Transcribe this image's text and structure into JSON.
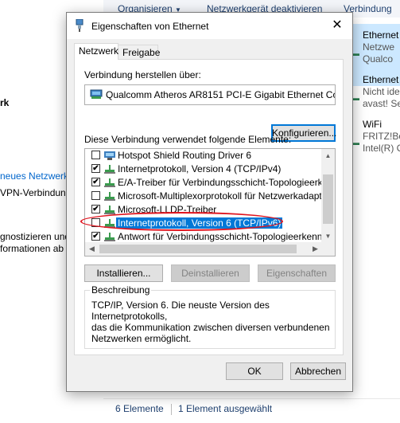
{
  "background": {
    "toolbar": {
      "organize": "Organisieren",
      "organize_arrow": "▼",
      "disable_device": "Netzwerkgerät deaktivieren",
      "connect": "Verbindung"
    },
    "left_pane": {
      "line1": "rk",
      "line2": "neues Netzwerk",
      "line3": "VPN-Verbindung",
      "line4": "gnostizieren und",
      "line5": "formationen ab"
    },
    "connections": [
      {
        "name": "Ethernet",
        "line2": "Netzwe",
        "line3": "Qualco"
      },
      {
        "name": "Ethernet",
        "line2": "Nicht ide",
        "line3": "avast! Se"
      },
      {
        "name": "WiFi",
        "line2": "FRITZ!Bo",
        "line3": "Intel(R) C"
      }
    ],
    "status": {
      "count": "6 Elemente",
      "selected": "1 Element ausgewählt"
    }
  },
  "dialog": {
    "title": "Eigenschaften von Ethernet",
    "close_glyph": "✕",
    "tabs": [
      {
        "label": "Netzwerk",
        "active": true
      },
      {
        "label": "Freigabe",
        "active": false
      }
    ],
    "connect_using_label": "Verbindung herstellen über:",
    "adapter_name": "Qualcomm Atheros AR8151 PCI-E Gigabit Ethernet Contro",
    "configure_button": "Konfigurieren...",
    "items_label": "Diese Verbindung verwendet folgende Elemente:",
    "items": [
      {
        "label": "Hotspot Shield Routing Driver 6",
        "checked": false,
        "selected": false
      },
      {
        "label": "Internetprotokoll, Version 4 (TCP/IPv4)",
        "checked": true,
        "selected": false
      },
      {
        "label": "E/A-Treiber für Verbindungsschicht-Topologieerkennur",
        "checked": true,
        "selected": false
      },
      {
        "label": "Microsoft-Multiplexorprotokoll für Netzwerkadapter",
        "checked": false,
        "selected": false
      },
      {
        "label": "Microsoft-LLDP-Treiber",
        "checked": true,
        "selected": false
      },
      {
        "label": "Internetprotokoll, Version 6 (TCP/IPv6)",
        "checked": false,
        "selected": true
      },
      {
        "label": "Antwort für Verbindungsschicht-Topologieerkennung",
        "checked": true,
        "selected": false
      }
    ],
    "check_glyph": "✔",
    "install_button": "Installieren...",
    "uninstall_button": "Deinstallieren",
    "properties_button": "Eigenschaften",
    "description_label": "Beschreibung",
    "description_text": "TCP/IP, Version 6. Die neuste Version des Internetprotokolls,\ndas die Kommunikation zwischen diversen verbundenen\nNetzwerken ermöglicht.",
    "ok_button": "OK",
    "cancel_button": "Abbrechen"
  },
  "colors": {
    "selection": "#0078d7",
    "highlight_ellipse": "#e0141e",
    "link": "#0066cc"
  }
}
